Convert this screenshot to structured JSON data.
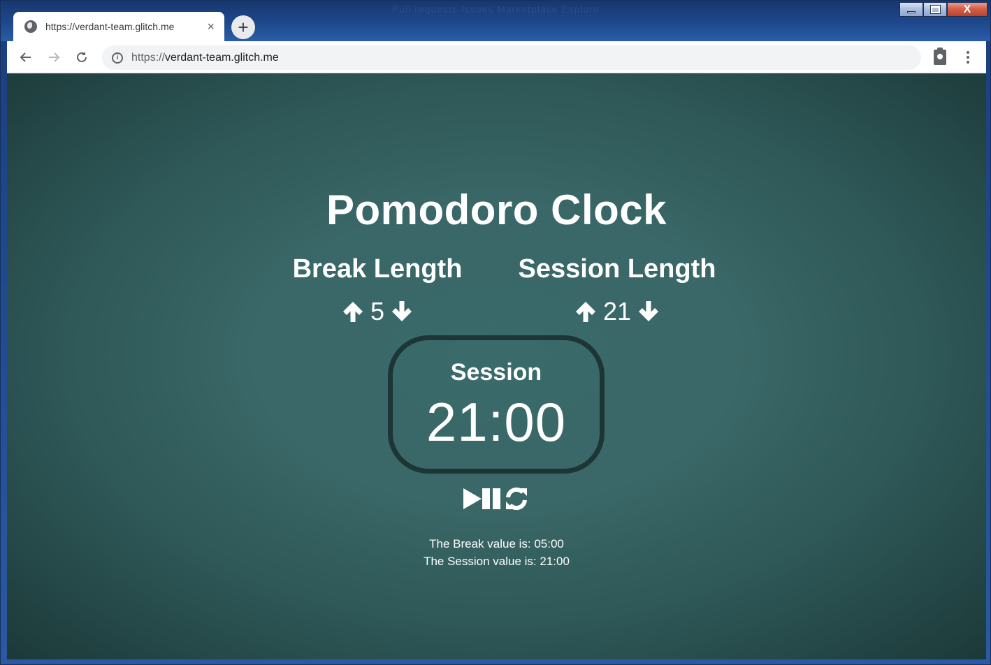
{
  "browser": {
    "tab_title": "https://verdant-team.glitch.me",
    "tab_close": "×",
    "new_tab": "+",
    "url_scheme": "https://",
    "url_host": "verdant-team.glitch.me",
    "back": "←",
    "forward": "→",
    "reload": "↻",
    "titlebar_ghost": "Pull requests   Issues   Marketplace   Explore"
  },
  "window_controls": {
    "close": "X"
  },
  "page": {
    "title": "Pomodoro Clock",
    "break": {
      "label": "Break Length",
      "value": "5"
    },
    "session": {
      "label": "Session Length",
      "value": "21"
    },
    "timer": {
      "label": "Session",
      "time": "21:00"
    },
    "info": {
      "break_line": "The Break value is: 05:00",
      "session_line": "The Session value is: 21:00"
    }
  },
  "icons": {
    "increment": "arrow-up-icon",
    "decrement": "arrow-down-icon",
    "play_pause": "play-pause-icon",
    "reset": "refresh-icon"
  },
  "colors": {
    "background_center": "#3a6a6a",
    "background_edge": "#1c3939",
    "timer_border": "#1d3535",
    "text": "#ffffff"
  }
}
